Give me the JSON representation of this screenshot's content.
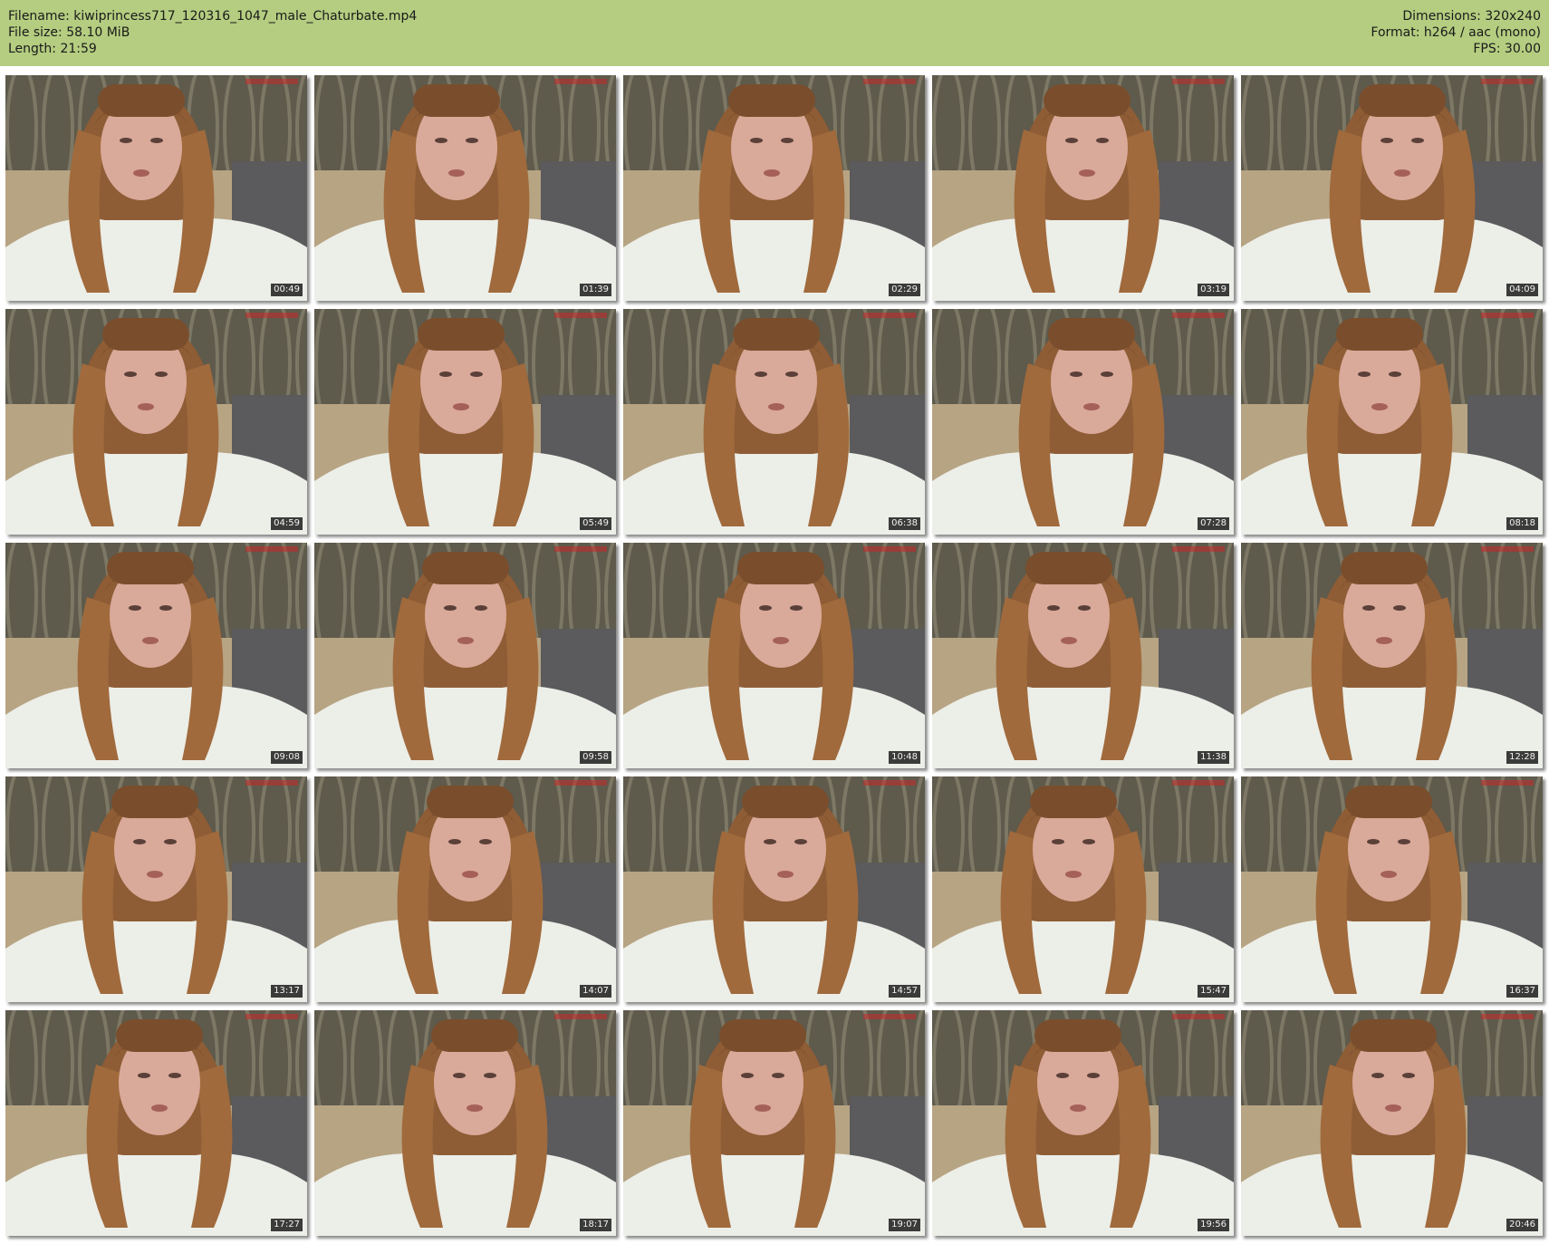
{
  "header": {
    "filename": "Filename: kiwiprincess717_120316_1047_male_Chaturbate.mp4",
    "filesize": "File size: 58.10 MiB",
    "length": "Length: 21:59",
    "dimensions": "Dimensions: 320x240",
    "format": "Format: h264 / aac (mono)",
    "fps": "FPS: 30.00"
  },
  "colors": {
    "header_bg": "#b4cd80",
    "background": "#ffffff"
  },
  "thumbnails": [
    {
      "time": "00:49"
    },
    {
      "time": "01:39"
    },
    {
      "time": "02:29"
    },
    {
      "time": "03:19"
    },
    {
      "time": "04:09"
    },
    {
      "time": "04:59"
    },
    {
      "time": "05:49"
    },
    {
      "time": "06:38"
    },
    {
      "time": "07:28"
    },
    {
      "time": "08:18"
    },
    {
      "time": "09:08"
    },
    {
      "time": "09:58"
    },
    {
      "time": "10:48"
    },
    {
      "time": "11:38"
    },
    {
      "time": "12:28"
    },
    {
      "time": "13:17"
    },
    {
      "time": "14:07"
    },
    {
      "time": "14:57"
    },
    {
      "time": "15:47"
    },
    {
      "time": "16:37"
    },
    {
      "time": "17:27"
    },
    {
      "time": "18:17"
    },
    {
      "time": "19:07"
    },
    {
      "time": "19:56"
    },
    {
      "time": "20:46"
    }
  ]
}
